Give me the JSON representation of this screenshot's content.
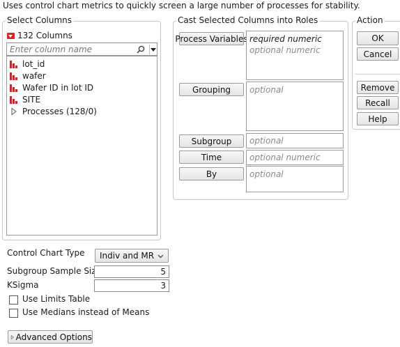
{
  "description": "Uses control chart metrics to quickly screen a large number of processes for stability.",
  "select_columns": {
    "title": "Select Columns",
    "count_label": "132 Columns",
    "search_placeholder": "Enter column name",
    "items": [
      {
        "label": "lot_id",
        "icon": "continuous-column-icon"
      },
      {
        "label": "wafer",
        "icon": "continuous-column-icon"
      },
      {
        "label": "Wafer ID in lot ID",
        "icon": "continuous-column-icon"
      },
      {
        "label": "SITE",
        "icon": "continuous-column-icon"
      },
      {
        "label": "Processes (128/0)",
        "icon": "expand-triangle-icon"
      }
    ]
  },
  "roles": {
    "title": "Cast Selected Columns into Roles",
    "process_variables": {
      "label": "Process Variables",
      "hint1": "required numeric",
      "hint2": "optional numeric"
    },
    "grouping": {
      "label": "Grouping",
      "hint": "optional"
    },
    "subgroup": {
      "label": "Subgroup",
      "hint": "optional"
    },
    "time": {
      "label": "Time",
      "hint": "optional numeric"
    },
    "by": {
      "label": "By",
      "hint": "optional"
    }
  },
  "action": {
    "title": "Action",
    "ok": "OK",
    "cancel": "Cancel",
    "remove": "Remove",
    "recall": "Recall",
    "help": "Help"
  },
  "options": {
    "chart_type_label": "Control Chart Type",
    "chart_type_value": "Indiv and MR",
    "subgroup_size_label": "Subgroup Sample Size",
    "subgroup_size_value": "5",
    "ksigma_label": "KSigma",
    "ksigma_value": "3",
    "use_limits_label": "Use Limits Table",
    "use_medians_label": "Use Medians instead of Means",
    "advanced_label": "Advanced Options"
  }
}
